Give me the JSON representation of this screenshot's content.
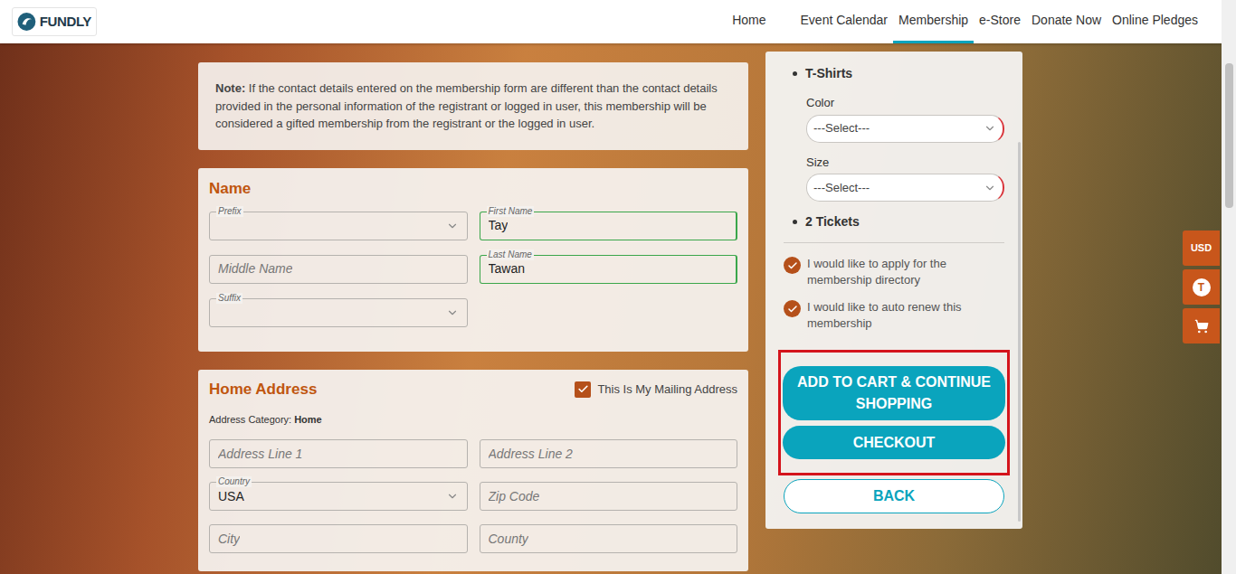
{
  "header": {
    "logo": "FUNDLY",
    "nav": [
      {
        "label": "Home",
        "selected": false
      },
      {
        "label": "Event Calendar",
        "selected": false
      },
      {
        "label": "Membership",
        "selected": true
      },
      {
        "label": "e-Store",
        "selected": false
      },
      {
        "label": "Donate Now",
        "selected": false
      },
      {
        "label": "Online Pledges",
        "selected": false
      }
    ]
  },
  "note": {
    "label": "Note:",
    "text": "If the contact details entered on the membership form are different than the contact details provided in the personal information of the registrant or logged in user, this membership will be considered a gifted membership from the registrant or the logged in user."
  },
  "name_section": {
    "title": "Name",
    "fields": [
      {
        "label": "Prefix",
        "value": "",
        "placeholder": "",
        "kind": "select",
        "valid": false
      },
      {
        "label": "First Name",
        "value": "Tay",
        "placeholder": "",
        "kind": "text",
        "valid": true
      },
      {
        "label": "",
        "value": "",
        "placeholder": "Middle Name",
        "kind": "text",
        "valid": false
      },
      {
        "label": "Last Name",
        "value": "Tawan",
        "placeholder": "",
        "kind": "text",
        "valid": true
      },
      {
        "label": "Suffix",
        "value": "",
        "placeholder": "",
        "kind": "select",
        "valid": false
      }
    ]
  },
  "address_section": {
    "title": "Home Address",
    "mailing": {
      "label": "This Is My Mailing Address",
      "checked": true
    },
    "category_label": "Address Category:",
    "category": "Home",
    "fields": [
      {
        "label": "",
        "value": "",
        "placeholder": "Address Line 1",
        "kind": "text",
        "valid": false
      },
      {
        "label": "",
        "value": "",
        "placeholder": "Address Line 2",
        "kind": "text",
        "valid": false
      },
      {
        "label": "Country",
        "value": "USA",
        "placeholder": "",
        "kind": "select",
        "valid": false
      },
      {
        "label": "",
        "value": "",
        "placeholder": "Zip Code",
        "kind": "text",
        "valid": false
      },
      {
        "label": "",
        "value": "",
        "placeholder": "City",
        "kind": "text",
        "valid": false
      },
      {
        "label": "",
        "value": "",
        "placeholder": "County",
        "kind": "text",
        "valid": false
      }
    ]
  },
  "sidebar": {
    "items": [
      {
        "kind": "bullet",
        "label": "T-Shirts"
      },
      {
        "kind": "select",
        "label": "Color",
        "value": "---Select---",
        "invalid": true
      },
      {
        "kind": "select",
        "label": "Size",
        "value": "---Select---",
        "invalid": true
      },
      {
        "kind": "bullet",
        "label": "2 Tickets"
      }
    ],
    "options": [
      {
        "label": "I would like to apply for the membership directory",
        "checked": true
      },
      {
        "label": "I would like to auto renew this membership",
        "checked": true
      }
    ],
    "action_groups": [
      {
        "highlighted": true,
        "buttons": [
          {
            "label": "ADD TO CART & CONTINUE SHOPPING",
            "kind": "primary"
          },
          {
            "label": "CHECKOUT",
            "kind": "primary"
          }
        ]
      },
      {
        "highlighted": false,
        "buttons": [
          {
            "label": "BACK",
            "kind": "outline"
          }
        ]
      }
    ]
  },
  "side_tabs": [
    {
      "kind": "text",
      "label": "USD"
    },
    {
      "kind": "avatar",
      "label": "T"
    },
    {
      "kind": "cart"
    }
  ]
}
